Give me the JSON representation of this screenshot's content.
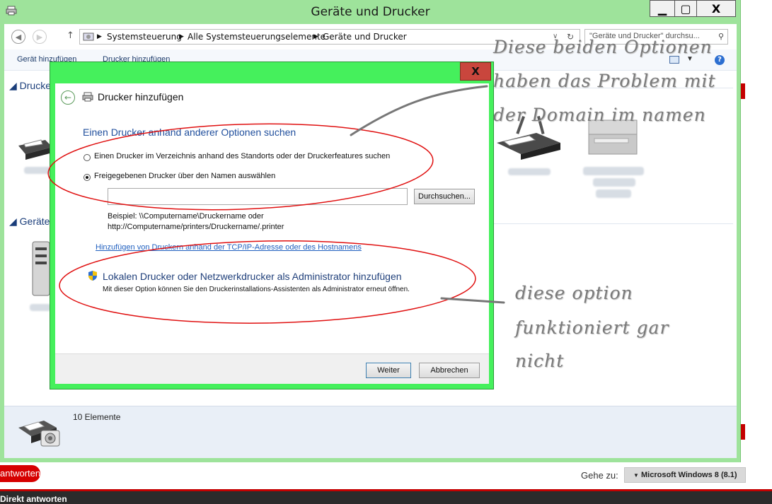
{
  "outer_window": {
    "title": "Geräte und Drucker",
    "controls": {
      "minimize": "▁",
      "maximize": "▢",
      "close": "X"
    }
  },
  "address_bar": {
    "segments": [
      "Systemsteuerung",
      "Alle Systemsteuerungselemente",
      "Geräte und Drucker"
    ],
    "search_placeholder": "\"Geräte und Drucker\" durchsu..."
  },
  "command_bar": {
    "add_device": "Gerät hinzufügen",
    "add_printer": "Drucker hinzufügen"
  },
  "content": {
    "section_printers": "Drucker",
    "section_devices": "Geräte"
  },
  "status": {
    "count": "10 Elemente"
  },
  "dialog": {
    "title": "Drucker hinzufügen",
    "close": "X",
    "heading": "Einen Drucker anhand anderer Optionen suchen",
    "option_directory": "Einen Drucker im Verzeichnis anhand des Standorts oder der Druckerfeatures suchen",
    "option_shared": "Freigegebenen Drucker über den Namen auswählen",
    "shared_name_value": "",
    "browse": "Durchsuchen...",
    "example_line1": "Beispiel: \\\\Computername\\Druckername oder",
    "example_line2": "http://Computername/printers/Druckername/.printer",
    "tcpip_link": "Hinzufügen von Druckern anhand der TCP/IP-Adresse oder des Hostnamens",
    "admin_option_title": "Lokalen Drucker oder Netzwerkdrucker als Administrator hinzufügen",
    "admin_option_desc": "Mit dieser Option können Sie den Druckerinstallations-Assistenten als Administrator erneut öffnen.",
    "next": "Weiter",
    "cancel": "Abbrechen"
  },
  "annotations": {
    "top_line1": "Diese beiden Optionen",
    "top_line2": "haben das Problem mit",
    "top_line3": "der Domain im namen",
    "bottom_line1": "diese option",
    "bottom_line2": "funktioniert gar",
    "bottom_line3": "nicht"
  },
  "page": {
    "reply_button": "antworten",
    "goto_label": "Gehe zu:",
    "goto_value": "Microsoft Windows 8 (8.1)",
    "bottom_text": "Direkt antworten"
  },
  "colors": {
    "dialog_frame": "#45f05c",
    "outer_frame": "#9ee39b",
    "annotation_ellipse": "#e01010",
    "heading_blue": "#1f4e9c"
  }
}
